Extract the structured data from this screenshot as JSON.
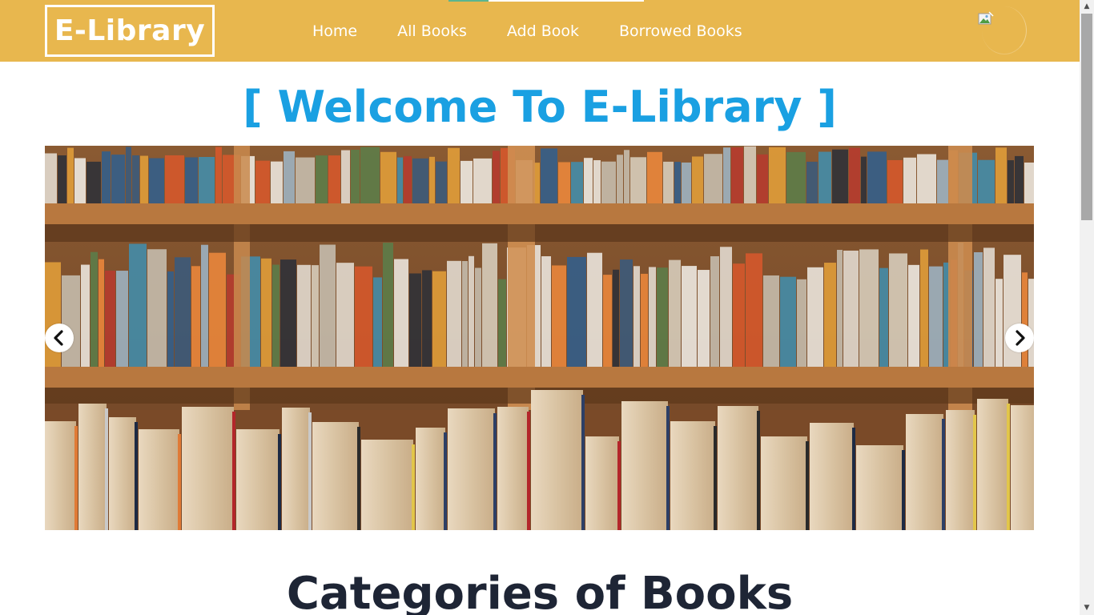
{
  "navbar": {
    "logo": "E-Library",
    "links": [
      "Home",
      "All Books",
      "Add Book",
      "Borrowed Books"
    ]
  },
  "hero": {
    "title": "[ Welcome To E-Library ]"
  },
  "carousel": {
    "prev_icon": "chevron-left-icon",
    "next_icon": "chevron-right-icon"
  },
  "section": {
    "title": "Categories of Books"
  },
  "colors": {
    "navbar": "#e8b74e",
    "title": "#1aa0e2",
    "heading": "#1e2535"
  }
}
